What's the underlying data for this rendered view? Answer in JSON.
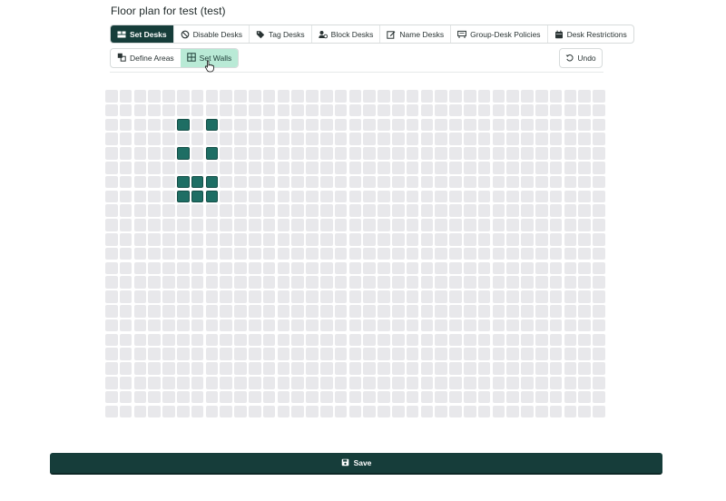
{
  "page": {
    "title": "Floor plan for test (test)"
  },
  "toolbar": {
    "tools": [
      {
        "label": "Set Desks",
        "icon": "set-desks-icon",
        "active": true
      },
      {
        "label": "Disable Desks",
        "icon": "disable-icon",
        "active": false
      },
      {
        "label": "Tag Desks",
        "icon": "tag-icon",
        "active": false
      },
      {
        "label": "Block Desks",
        "icon": "block-user-icon",
        "active": false
      },
      {
        "label": "Name Desks",
        "icon": "edit-icon",
        "active": false
      },
      {
        "label": "Group-Desk Policies",
        "icon": "group-policy-icon",
        "active": false
      },
      {
        "label": "Desk Restrictions",
        "icon": "calendar-icon",
        "active": false
      }
    ]
  },
  "subtoolbar": {
    "tools": [
      {
        "label": "Define Areas",
        "icon": "define-areas-icon",
        "active": false
      },
      {
        "label": "Set Walls",
        "icon": "walls-grid-icon",
        "active": true
      }
    ]
  },
  "undo": {
    "label": "Undo",
    "icon": "undo-icon"
  },
  "grid": {
    "columns": 35,
    "rows": 23,
    "desks": [
      [
        5,
        2
      ],
      [
        7,
        2
      ],
      [
        5,
        4
      ],
      [
        7,
        4
      ],
      [
        5,
        6
      ],
      [
        6,
        6
      ],
      [
        7,
        6
      ],
      [
        5,
        7
      ],
      [
        6,
        7
      ],
      [
        7,
        7
      ]
    ]
  },
  "save": {
    "label": "Save",
    "icon": "save-icon"
  },
  "colors": {
    "primary": "#163d3a",
    "desk": "#1e6e64",
    "active_subtool": "#b9ead6",
    "empty_cell": "#e8e8eb"
  }
}
